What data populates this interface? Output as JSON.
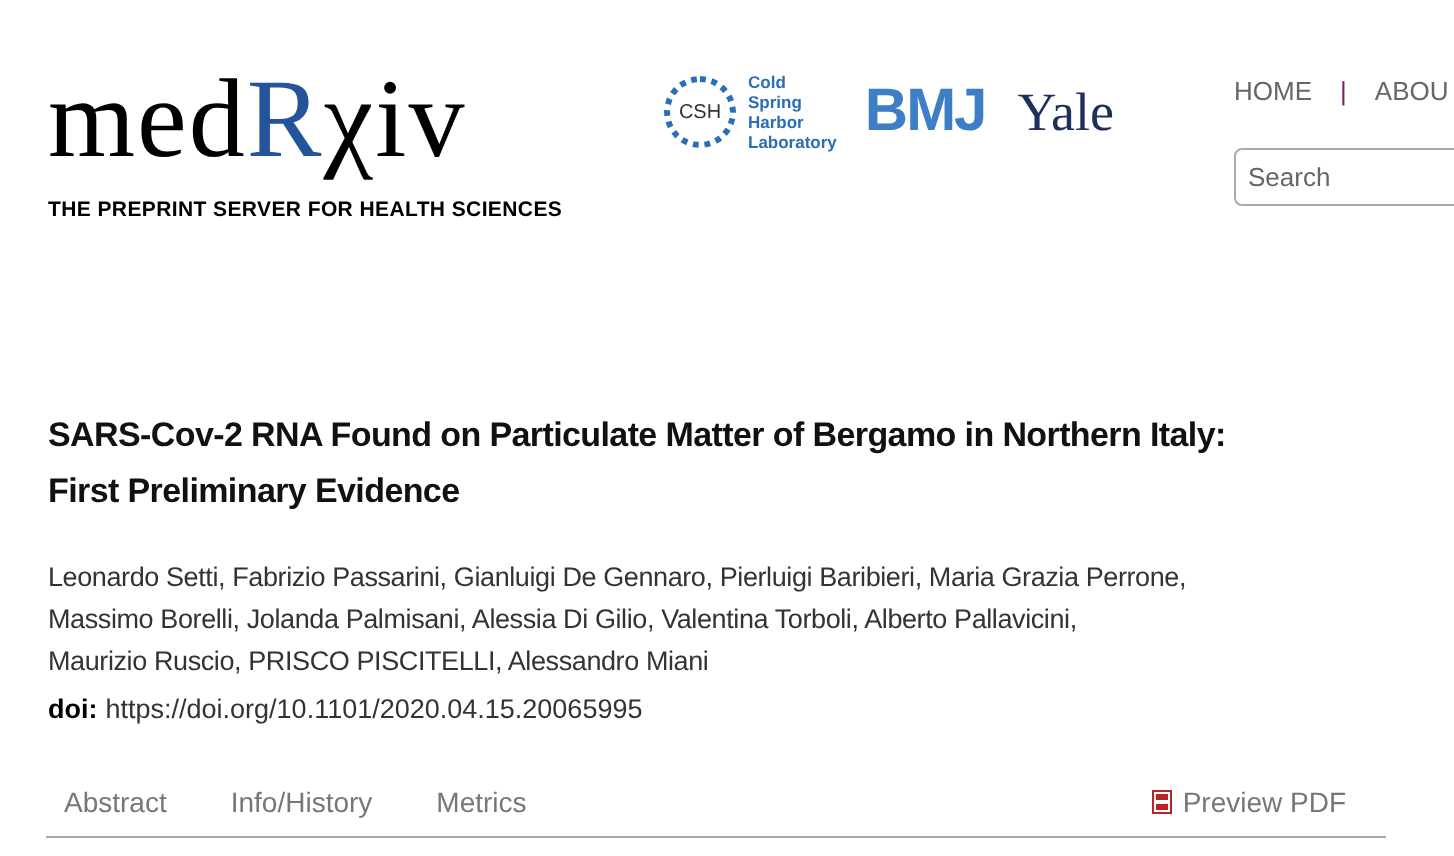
{
  "header": {
    "logo": {
      "parts": [
        {
          "text": "med",
          "accent": false
        },
        {
          "text": "R",
          "accent": true
        },
        {
          "text": "χiv",
          "accent": false
        }
      ],
      "tagline": "THE PREPRINT SERVER FOR HEALTH SCIENCES"
    },
    "partners": [
      {
        "kind": "csh",
        "mark": "CSH",
        "lines": [
          "Cold",
          "Spring",
          "Harbor",
          "Laboratory"
        ]
      },
      {
        "kind": "bmj",
        "mark": "BMJ"
      },
      {
        "kind": "yale",
        "mark": "Yale"
      }
    ],
    "nav": [
      "HOME",
      "ABOU"
    ],
    "nav_separator": "|",
    "search": {
      "placeholder": "Search"
    }
  },
  "article": {
    "title": [
      "SARS-Cov-2 RNA Found on Particulate Matter of Bergamo in Northern Italy:",
      "First Preliminary Evidence"
    ],
    "authors": [
      "Leonardo Setti, Fabrizio Passarini, Gianluigi De Gennaro, Pierluigi Baribieri, Maria Grazia Perrone,",
      "Massimo Borelli, Jolanda Palmisani, Alessia Di Gilio, Valentina Torboli, Alberto Pallavicini,",
      "Maurizio Ruscio, PRISCO PISCITELLI, Alessandro Miani"
    ],
    "doi_label": "doi:",
    "doi": "https://doi.org/10.1101/2020.04.15.20065995"
  },
  "tabs": [
    {
      "label": "Abstract",
      "selected": false
    },
    {
      "label": "Info/History",
      "selected": false
    },
    {
      "label": "Metrics",
      "selected": false
    }
  ],
  "preview_pdf": "Preview PDF"
}
